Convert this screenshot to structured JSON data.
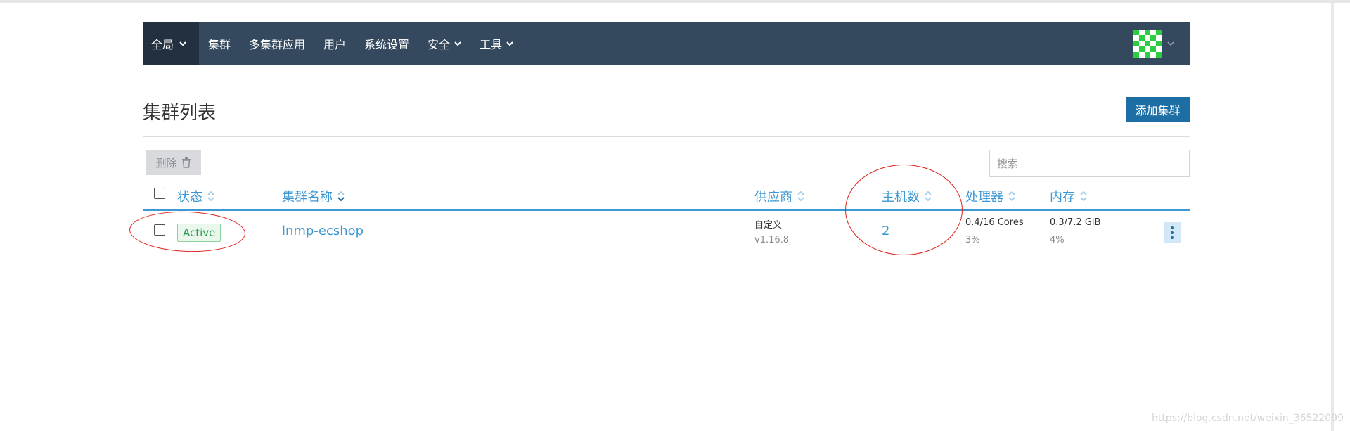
{
  "nav": {
    "items": [
      {
        "label": "全局",
        "has_dropdown": true,
        "active": true
      },
      {
        "label": "集群",
        "has_dropdown": false
      },
      {
        "label": "多集群应用",
        "has_dropdown": false
      },
      {
        "label": "用户",
        "has_dropdown": false
      },
      {
        "label": "系统设置",
        "has_dropdown": false
      },
      {
        "label": "安全",
        "has_dropdown": true
      },
      {
        "label": "工具",
        "has_dropdown": true
      }
    ],
    "logo_icon": "rancher-cow-logo",
    "avatar_icon": "identicon-avatar"
  },
  "page": {
    "title": "集群列表",
    "add_button": "添加集群"
  },
  "toolbar": {
    "delete_label": "删除",
    "delete_icon": "trash-icon",
    "search_placeholder": "搜索"
  },
  "table": {
    "columns": [
      "状态",
      "集群名称",
      "供应商",
      "主机数",
      "处理器",
      "内存"
    ],
    "rows": [
      {
        "status": "Active",
        "name": "lnmp-ecshop",
        "provider": "自定义",
        "provider_version": "v1.16.8",
        "hosts": "2",
        "cpu": "0.4/16 Cores",
        "cpu_pct": "3%",
        "memory": "0.3/7.2 GiB",
        "memory_pct": "4%"
      }
    ]
  },
  "watermark": "https://blog.csdn.net/weixin_36522099",
  "colors": {
    "header": "#35495e",
    "header_active": "#22303f",
    "accent": "#3d98d3",
    "primary_button": "#1c6ea4",
    "annotation": "#e0221b"
  }
}
